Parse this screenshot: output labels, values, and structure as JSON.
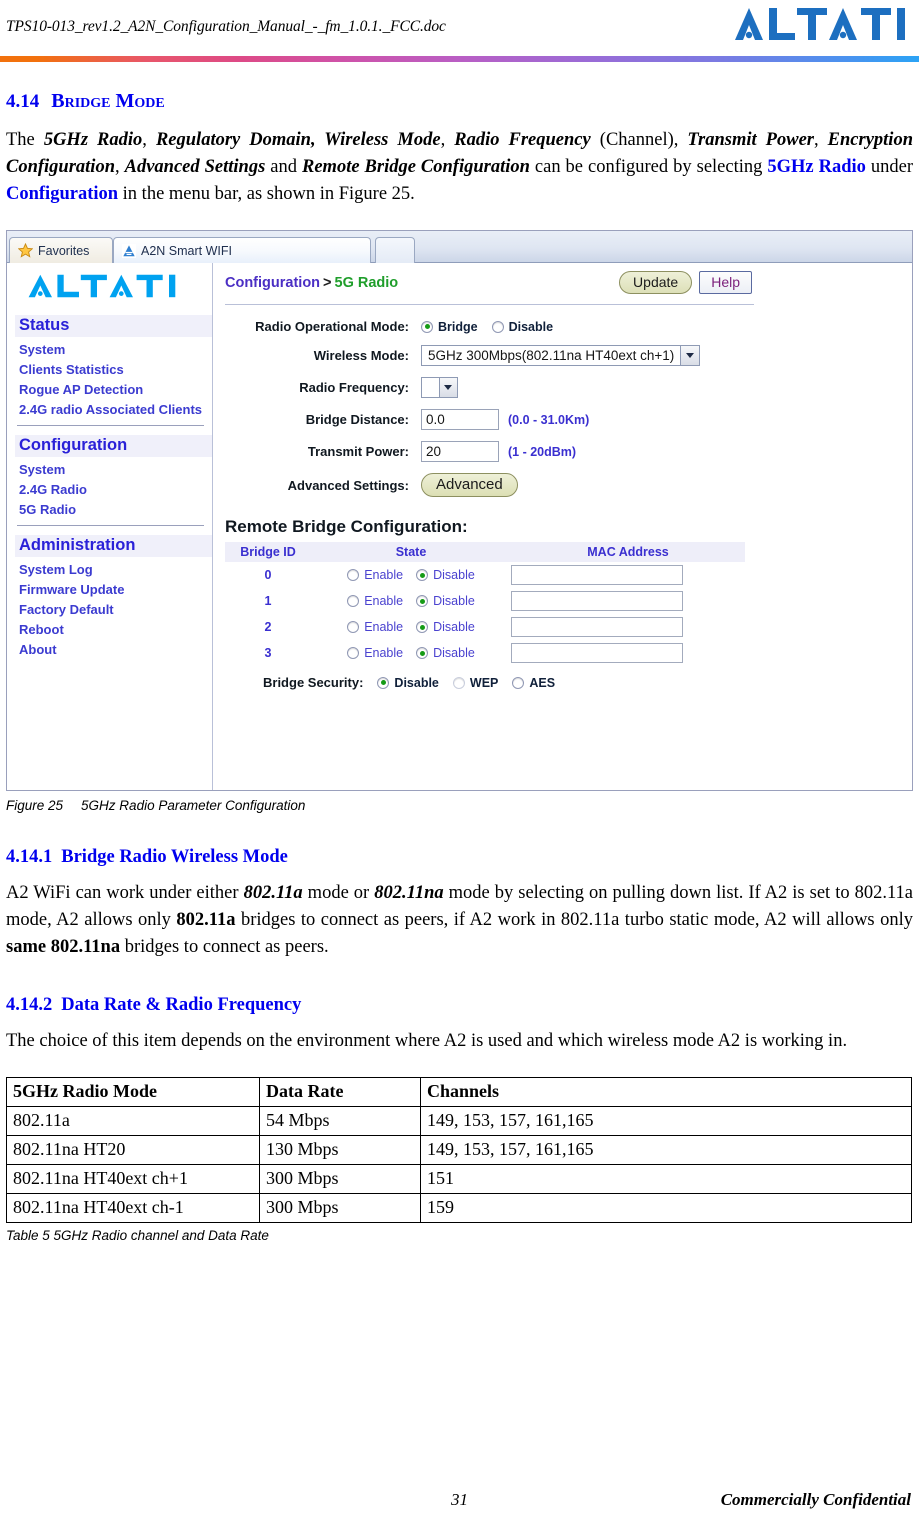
{
  "doc": {
    "header_title": "TPS10-013_rev1.2_A2N_Configuration_Manual_-_fm_1.0.1._FCC.doc",
    "logo_text": "ALTAI"
  },
  "section": {
    "number": "4.14",
    "title": "Bridge Mode",
    "paragraph_parts": {
      "p1": "The ",
      "b1": "5GHz Radio",
      "p2": ", ",
      "b2": "Regulatory Domain, Wireless Mode",
      "p3": ", ",
      "b3": "Radio Frequency",
      "p4": " (Channel), ",
      "b4": "Transmit Power",
      "p5": ", ",
      "b5": "Encryption Configuration",
      "p6": ", ",
      "b6": "Advanced Settings",
      "p7": " and ",
      "b7": "Remote Bridge Configuration",
      "p8": " can be configured by selecting ",
      "l1": "5GHz Radio",
      "p9": " under ",
      "l2": "Configuration",
      "p10": " in the menu bar, as shown in Figure 25."
    }
  },
  "figure": {
    "caption_label": "Figure 25",
    "caption_text": "5GHz Radio Parameter Configuration",
    "browser": {
      "tabs": [
        {
          "label": "Favorites",
          "icon": "star-icon"
        },
        {
          "label": "A2N Smart WIFI",
          "icon": "altai-favicon"
        }
      ]
    },
    "web": {
      "logo_text": "ALTAI",
      "breadcrumb": {
        "parent": "Configuration",
        "separator": ">",
        "current": "5G Radio"
      },
      "buttons": {
        "update": "Update",
        "help": "Help"
      },
      "sidebar": [
        {
          "heading": "Status",
          "items": [
            "System",
            "Clients Statistics",
            "Rogue AP Detection",
            "2.4G radio Associated Clients"
          ]
        },
        {
          "heading": "Configuration",
          "items": [
            "System",
            "2.4G Radio",
            "5G Radio"
          ]
        },
        {
          "heading": "Administration",
          "items": [
            "System Log",
            "Firmware Update",
            "Factory Default",
            "Reboot",
            "About"
          ]
        }
      ],
      "form": {
        "radio_operational_mode": {
          "label": "Radio Operational Mode:",
          "options": [
            "Bridge",
            "Disable"
          ],
          "selected": "Bridge"
        },
        "wireless_mode": {
          "label": "Wireless Mode:",
          "value": "5GHz 300Mbps(802.11na HT40ext ch+1)"
        },
        "radio_frequency": {
          "label": "Radio Frequency:",
          "value": ""
        },
        "bridge_distance": {
          "label": "Bridge Distance:",
          "value": "0.0",
          "hint": "(0.0 - 31.0Km)"
        },
        "transmit_power": {
          "label": "Transmit Power:",
          "value": "20",
          "hint": "(1 - 20dBm)"
        },
        "advanced_settings": {
          "label": "Advanced Settings:",
          "button": "Advanced"
        }
      },
      "remote_bridge": {
        "title": "Remote Bridge Configuration:",
        "columns": [
          "Bridge ID",
          "State",
          "MAC Address"
        ],
        "state_options": [
          "Enable",
          "Disable"
        ],
        "rows": [
          {
            "id": "0",
            "state": "Disable",
            "mac": ""
          },
          {
            "id": "1",
            "state": "Disable",
            "mac": ""
          },
          {
            "id": "2",
            "state": "Disable",
            "mac": ""
          },
          {
            "id": "3",
            "state": "Disable",
            "mac": ""
          }
        ],
        "security": {
          "label": "Bridge Security:",
          "options": [
            "Disable",
            "WEP",
            "AES"
          ],
          "selected": "Disable"
        }
      }
    }
  },
  "subsection_1": {
    "number": "4.14.1",
    "title": "Bridge Radio Wireless Mode",
    "parts": {
      "p1": "A2 WiFi can work under either ",
      "b1": "802.11a",
      "p2": " mode or ",
      "b2": "802.11na",
      "p3": " mode by selecting on pulling down list. If A2 is set to 802.11a mode, A2 allows only ",
      "b3": "802.11a",
      "p4": " bridges to connect as peers, if A2 work in 802.11a turbo static mode, A2 will allows only ",
      "b4": "same 802.11na",
      "p5": " bridges to connect as peers."
    }
  },
  "subsection_2": {
    "number": "4.14.2",
    "title": "Data Rate & Radio Frequency",
    "paragraph": "The choice of this item depends on the environment where A2 is used and which wireless mode A2 is working in."
  },
  "data_table": {
    "headers": [
      "5GHz Radio Mode",
      "Data Rate",
      "Channels"
    ],
    "rows": [
      [
        "802.11a",
        "54 Mbps",
        "149, 153, 157, 161,165"
      ],
      [
        "802.11na HT20",
        "130 Mbps",
        "149, 153, 157, 161,165"
      ],
      [
        "802.11na HT40ext ch+1",
        "300 Mbps",
        "151"
      ],
      [
        "802.11na HT40ext ch-1",
        "300 Mbps",
        "159"
      ]
    ],
    "caption": "Table 5 5GHz Radio channel and Data Rate"
  },
  "footer": {
    "page_number": "31",
    "confidentiality": "Commercially Confidential"
  }
}
